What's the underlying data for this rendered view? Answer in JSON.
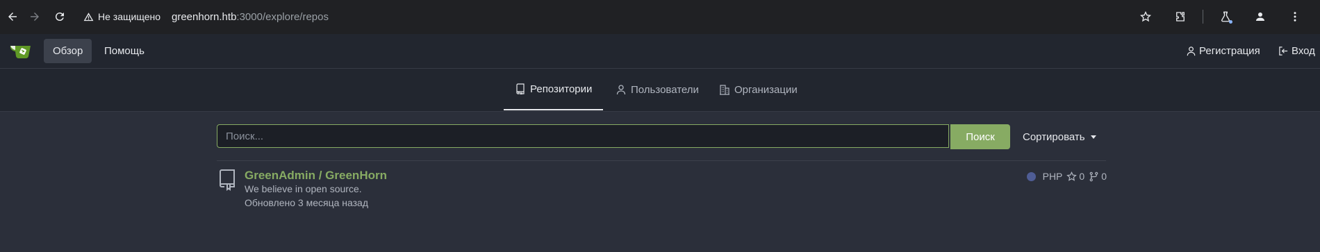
{
  "browser": {
    "security_label": "Не защищено",
    "url_host": "greenhorn.htb",
    "url_rest": ":3000/explore/repos"
  },
  "nav": {
    "explore_label": "Обзор",
    "help_label": "Помощь",
    "register_label": "Регистрация",
    "login_label": "Вход"
  },
  "tabs": [
    {
      "label": "Репозитории",
      "icon": "repo-icon",
      "active": true
    },
    {
      "label": "Пользователи",
      "icon": "person-icon"
    },
    {
      "label": "Организации",
      "icon": "organization-icon"
    }
  ],
  "search": {
    "placeholder": "Поиск...",
    "value": "",
    "button_label": "Поиск",
    "sort_label": "Сортировать"
  },
  "repos": [
    {
      "title": "GreenAdmin / GreenHorn",
      "description": "We believe in open source.",
      "updated": "Обновлено 3 месяца назад",
      "language": "PHP",
      "language_color": "#4f5d95",
      "stars": "0",
      "forks": "0"
    }
  ],
  "colors": {
    "accent": "#87ab63",
    "background": "#2b2f3a",
    "header": "#22262f"
  }
}
